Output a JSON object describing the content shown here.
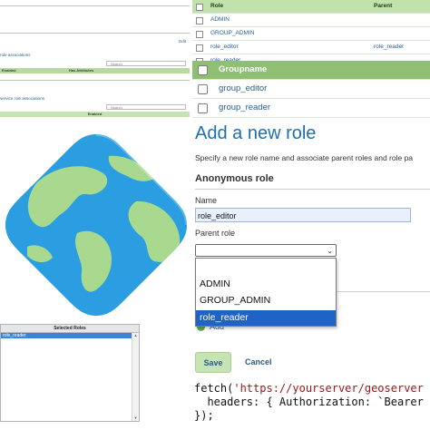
{
  "left_panel": {
    "edit_link": "Edit",
    "caption_top": "role associations",
    "search_placeholder_top": "Search",
    "table_top": {
      "col1": "Enabled",
      "col2": "Has Attributes"
    },
    "caption_bottom": "service role associations",
    "search_placeholder_bottom": "Search",
    "band_label": "Enabled",
    "selected_roles": {
      "header": "Selected Roles",
      "rows": [
        "role_reader"
      ]
    }
  },
  "roles_table": {
    "headers": {
      "role": "Role",
      "parent": "Parent"
    },
    "rows": [
      {
        "role": "ADMIN",
        "parent": ""
      },
      {
        "role": "GROUP_ADMIN",
        "parent": ""
      },
      {
        "role": "role_editor",
        "parent": "role_reader"
      },
      {
        "role": "role_reader",
        "parent": ""
      }
    ]
  },
  "groups_table": {
    "header": "Groupname",
    "rows": [
      "group_editor",
      "group_reader"
    ]
  },
  "form": {
    "title": "Add a new role",
    "intro": "Specify a new role name and associate parent roles and role pa",
    "section": "Anonymous role",
    "name_label": "Name",
    "name_value": "role_editor",
    "parent_label": "Parent role",
    "parent_options": [
      "",
      "ADMIN",
      "GROUP_ADMIN",
      "role_reader"
    ],
    "parent_selected": "role_reader",
    "add_link": "Add",
    "save_label": "Save",
    "cancel_label": "Cancel"
  },
  "code": {
    "line1_fn": "fetch(",
    "line1_str": "'https://yourserver/geoserver",
    "line2": "  headers: { Authorization: `Bearer",
    "line3": "});"
  },
  "colors": {
    "header_green": "#c2e2ad",
    "group_header_green": "#8fbf73",
    "title_blue": "#1f6faa",
    "selection_blue": "#1e63c5",
    "save_green": "#c6e3b3"
  }
}
